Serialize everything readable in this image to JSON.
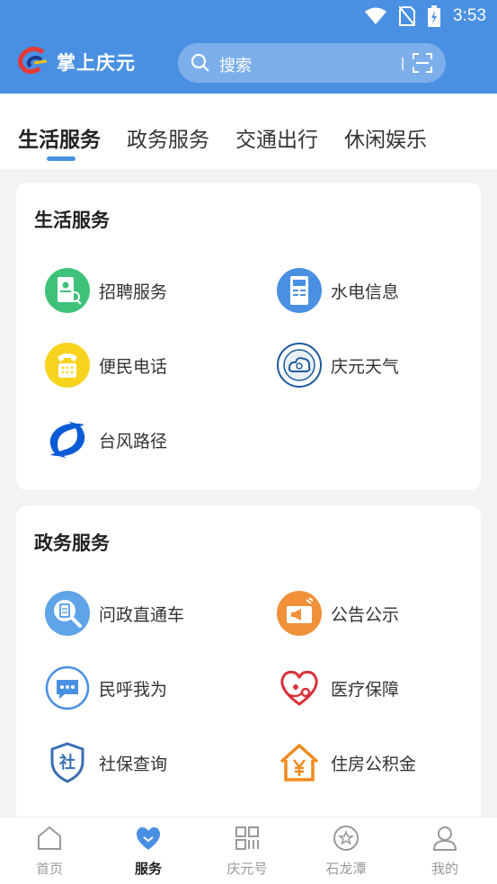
{
  "status": {
    "time": "3:53"
  },
  "app": {
    "title": "掌上庆元"
  },
  "search": {
    "placeholder": "搜索"
  },
  "tabs": [
    {
      "label": "生活服务",
      "active": true
    },
    {
      "label": "政务服务"
    },
    {
      "label": "交通出行"
    },
    {
      "label": "休闲娱乐"
    }
  ],
  "sections": [
    {
      "title": "生活服务",
      "items": [
        {
          "label": "招聘服务",
          "icon": "recruit-icon"
        },
        {
          "label": "水电信息",
          "icon": "utility-icon"
        },
        {
          "label": "便民电话",
          "icon": "phone-icon"
        },
        {
          "label": "庆元天气",
          "icon": "weather-icon"
        },
        {
          "label": "台风路径",
          "icon": "typhoon-icon"
        }
      ]
    },
    {
      "title": "政务服务",
      "items": [
        {
          "label": "问政直通车",
          "icon": "inquiry-icon"
        },
        {
          "label": "公告公示",
          "icon": "announcement-icon"
        },
        {
          "label": "民呼我为",
          "icon": "chat-icon"
        },
        {
          "label": "医疗保障",
          "icon": "medical-icon"
        },
        {
          "label": "社保查询",
          "icon": "social-security-icon"
        },
        {
          "label": "住房公积金",
          "icon": "housing-fund-icon"
        }
      ]
    }
  ],
  "nav": [
    {
      "label": "首页",
      "icon": "home-icon"
    },
    {
      "label": "服务",
      "icon": "service-heart-icon",
      "active": true
    },
    {
      "label": "庆元号",
      "icon": "grid-icon"
    },
    {
      "label": "石龙潭",
      "icon": "star-circle-icon"
    },
    {
      "label": "我的",
      "icon": "profile-icon"
    }
  ],
  "colors": {
    "brand": "#4a90e2",
    "text": "#222222",
    "muted": "#999999"
  }
}
